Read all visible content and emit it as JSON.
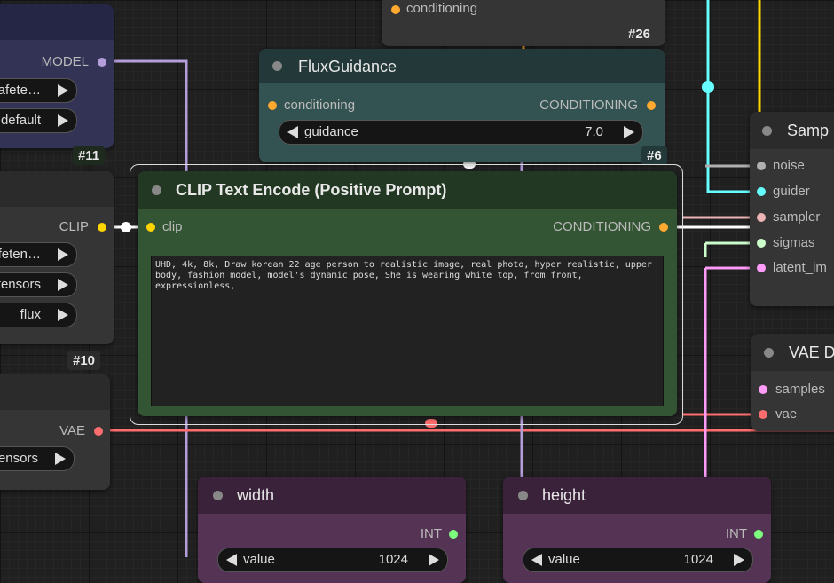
{
  "top_node": {
    "slot_label": "conditioning",
    "badge": "#26"
  },
  "flux_guidance": {
    "title": "FluxGuidance",
    "input_label": "conditioning",
    "output_label": "CONDITIONING",
    "widget_label": "guidance",
    "widget_value": "7.0",
    "badge": "#6"
  },
  "model_loader": {
    "output_label": "MODEL",
    "widget1_value": "afete…",
    "widget2_value": "default",
    "badge": "#11"
  },
  "clip_loader": {
    "output_label": "CLIP",
    "widget1_value": "afeten…",
    "widget2_value": "tensors",
    "widget3_value": "flux",
    "badge": "#10"
  },
  "vae_loader": {
    "output_label": "VAE",
    "widget1_value": "ensors"
  },
  "clip_text_encode": {
    "title": "CLIP Text Encode (Positive Prompt)",
    "input_label": "clip",
    "output_label": "CONDITIONING",
    "prompt": "UHD, 4k, 8k, Draw korean 22 age person to realistic image, real photo, hyper realistic, upper body, fashion model, model's dynamic pose, She is wearing white top, from front, expressionless,"
  },
  "sampler": {
    "title": "Samp",
    "inputs": [
      "noise",
      "guider",
      "sampler",
      "sigmas",
      "latent_im"
    ]
  },
  "vae_decode": {
    "title": "VAE D",
    "inputs": [
      "samples",
      "vae"
    ]
  },
  "width_node": {
    "title": "width",
    "output_label": "INT",
    "widget_label": "value",
    "widget_value": "1024"
  },
  "height_node": {
    "title": "height",
    "output_label": "INT",
    "widget_label": "value",
    "widget_value": "1024"
  },
  "colors": {
    "conditioning": "#ffa931",
    "clip": "#ffd500",
    "model": "#b39ddb",
    "vae": "#ff6e6e",
    "int": "#7eff7e",
    "guider": "#66ffff",
    "noise": "#b0b0b0",
    "sampler_link": "#ecb4b4",
    "sigmas": "#cdffcd",
    "latent": "#ff9cf9"
  }
}
